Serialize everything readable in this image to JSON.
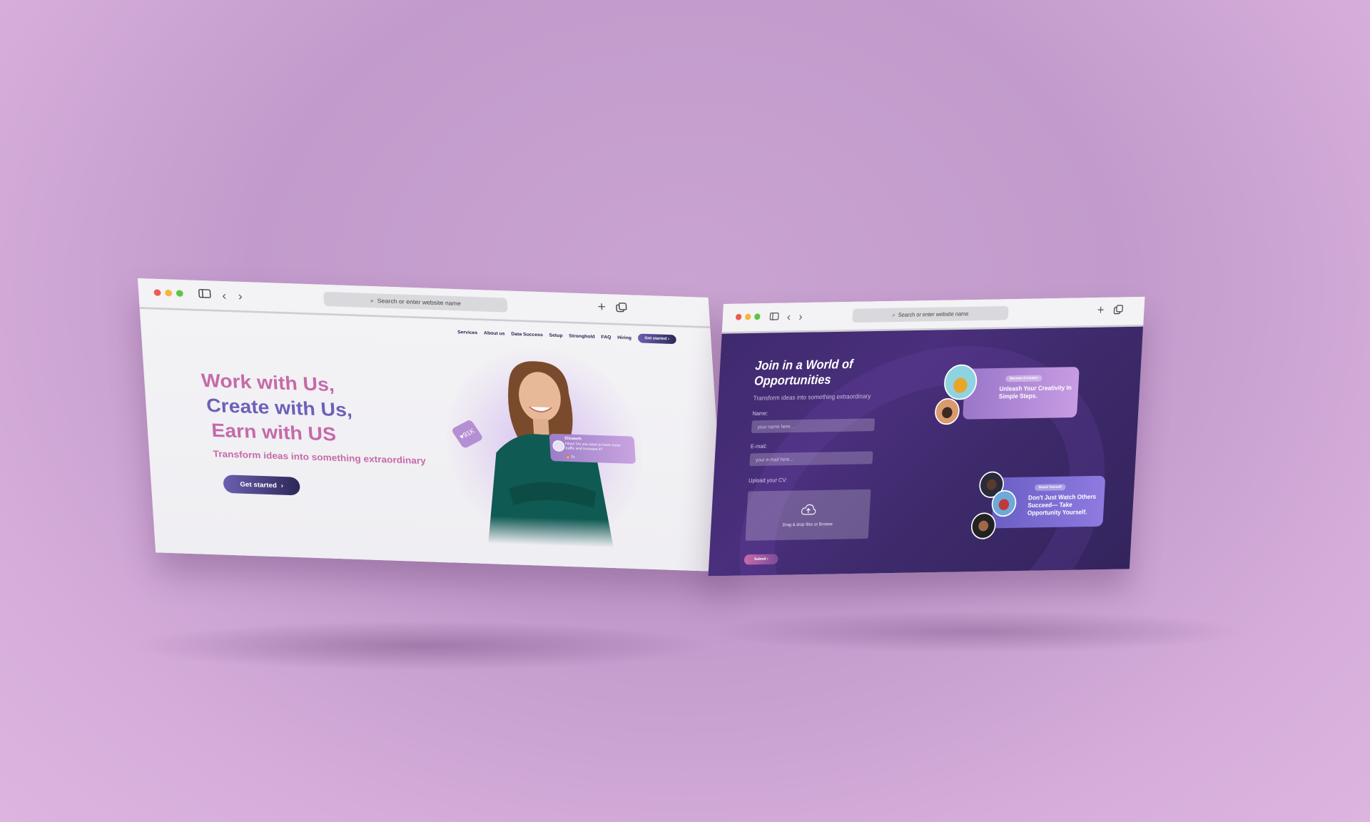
{
  "colors": {
    "backdrop": "#c9a3d1",
    "hero_pink": "#c56aa9",
    "hero_violet": "#6e5fb8",
    "dark_navy": "#2b2857",
    "form_bg": "#3f2a6e"
  },
  "browser_left": {
    "url_placeholder": "Search or enter website name",
    "nav": {
      "items": [
        "Services",
        "About us",
        "Data Success",
        "Setup",
        "Stronghold",
        "FAQ",
        "Hiring"
      ],
      "cta_label": "Get started ›"
    },
    "hero": {
      "line1": "Work with Us,",
      "line2": "Create with Us,",
      "line3": "Earn with US",
      "subtitle": "Transform ideas into something extraordinary",
      "cta_label": "Get started",
      "cta_arrow": "›"
    },
    "like_badge": "91K",
    "chat": {
      "name": "Elizabeth",
      "message": "Heyy! Do you want to have more traffic and increase it?",
      "footer": "🔥 5s"
    }
  },
  "browser_right": {
    "url_placeholder": "Search or enter website name",
    "form": {
      "title": "Join in a World of Opportunities",
      "subtitle": "Transform ideas into something extraordinary",
      "name_label": "Name:",
      "name_placeholder": "your name here...",
      "email_label": "E-mail:",
      "email_placeholder": "your e-mail here...",
      "cv_label": "Upload your CV:",
      "drop_text": "Drag & drop files or Browse",
      "submit_label": "Submit ›"
    },
    "promos": [
      {
        "badge": "Become A Creator",
        "text": "Unleash Your Creativity In Simple Steps."
      },
      {
        "badge": "Brand Yourself",
        "text": "Don't Just Watch Others Succeed— Take Opportunity Yourself."
      }
    ]
  }
}
